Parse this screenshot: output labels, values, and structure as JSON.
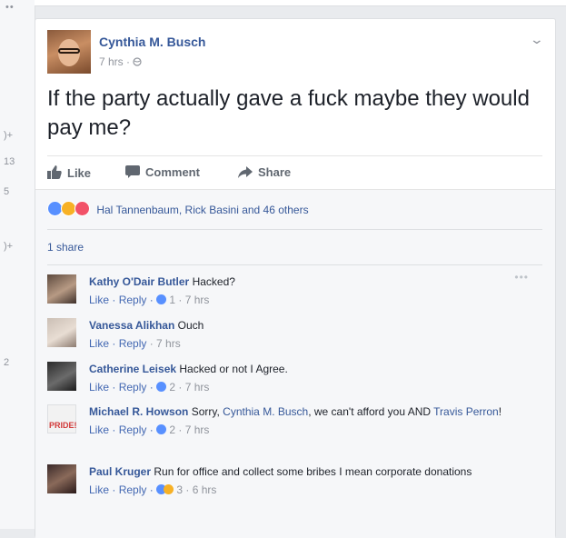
{
  "left_strip": {
    "dots": "••",
    "numbers": [
      ")+",
      "13",
      "5",
      ")+",
      "2"
    ]
  },
  "post": {
    "author": "Cynthia M. Busch",
    "time": "7 hrs",
    "dot": "·",
    "text": "If the party actually gave a fuck maybe they would pay me?",
    "actions": {
      "like": "Like",
      "comment": "Comment",
      "share": "Share"
    },
    "reactions_text": "Hal Tannenbaum, Rick Basini and 46 others",
    "shares_text": "1 share",
    "colors": {
      "link": "#365899",
      "like_blue": "#5890ff",
      "wow": "#f7b125",
      "love": "#f25268"
    }
  },
  "comments": [
    {
      "name": "Kathy O'Dair Butler",
      "text": "Hacked?",
      "like": "Like",
      "reply": "Reply",
      "reactions": "1",
      "time": "7 hrs"
    },
    {
      "name": "Vanessa Alikhan",
      "text": "Ouch",
      "like": "Like",
      "reply": "Reply",
      "time": "7 hrs"
    },
    {
      "name": "Catherine Leisek",
      "text": "Hacked or not I Agree.",
      "like": "Like",
      "reply": "Reply",
      "reactions": "2",
      "time": "7 hrs"
    },
    {
      "name": "Michael R. Howson",
      "text_pre": "Sorry,",
      "mention1": "Cynthia M. Busch",
      "text_mid": ", we can't afford you AND",
      "mention2": "Travis Perron",
      "text_post": "!",
      "like": "Like",
      "reply": "Reply",
      "reactions": "2",
      "time": "7 hrs",
      "avatar_text": "PRIDE!"
    },
    {
      "name": "Paul Kruger",
      "text": "Run for office and collect some bribes I mean corporate donations",
      "like": "Like",
      "reply": "Reply",
      "reactions": "3",
      "time": "6 hrs"
    }
  ]
}
